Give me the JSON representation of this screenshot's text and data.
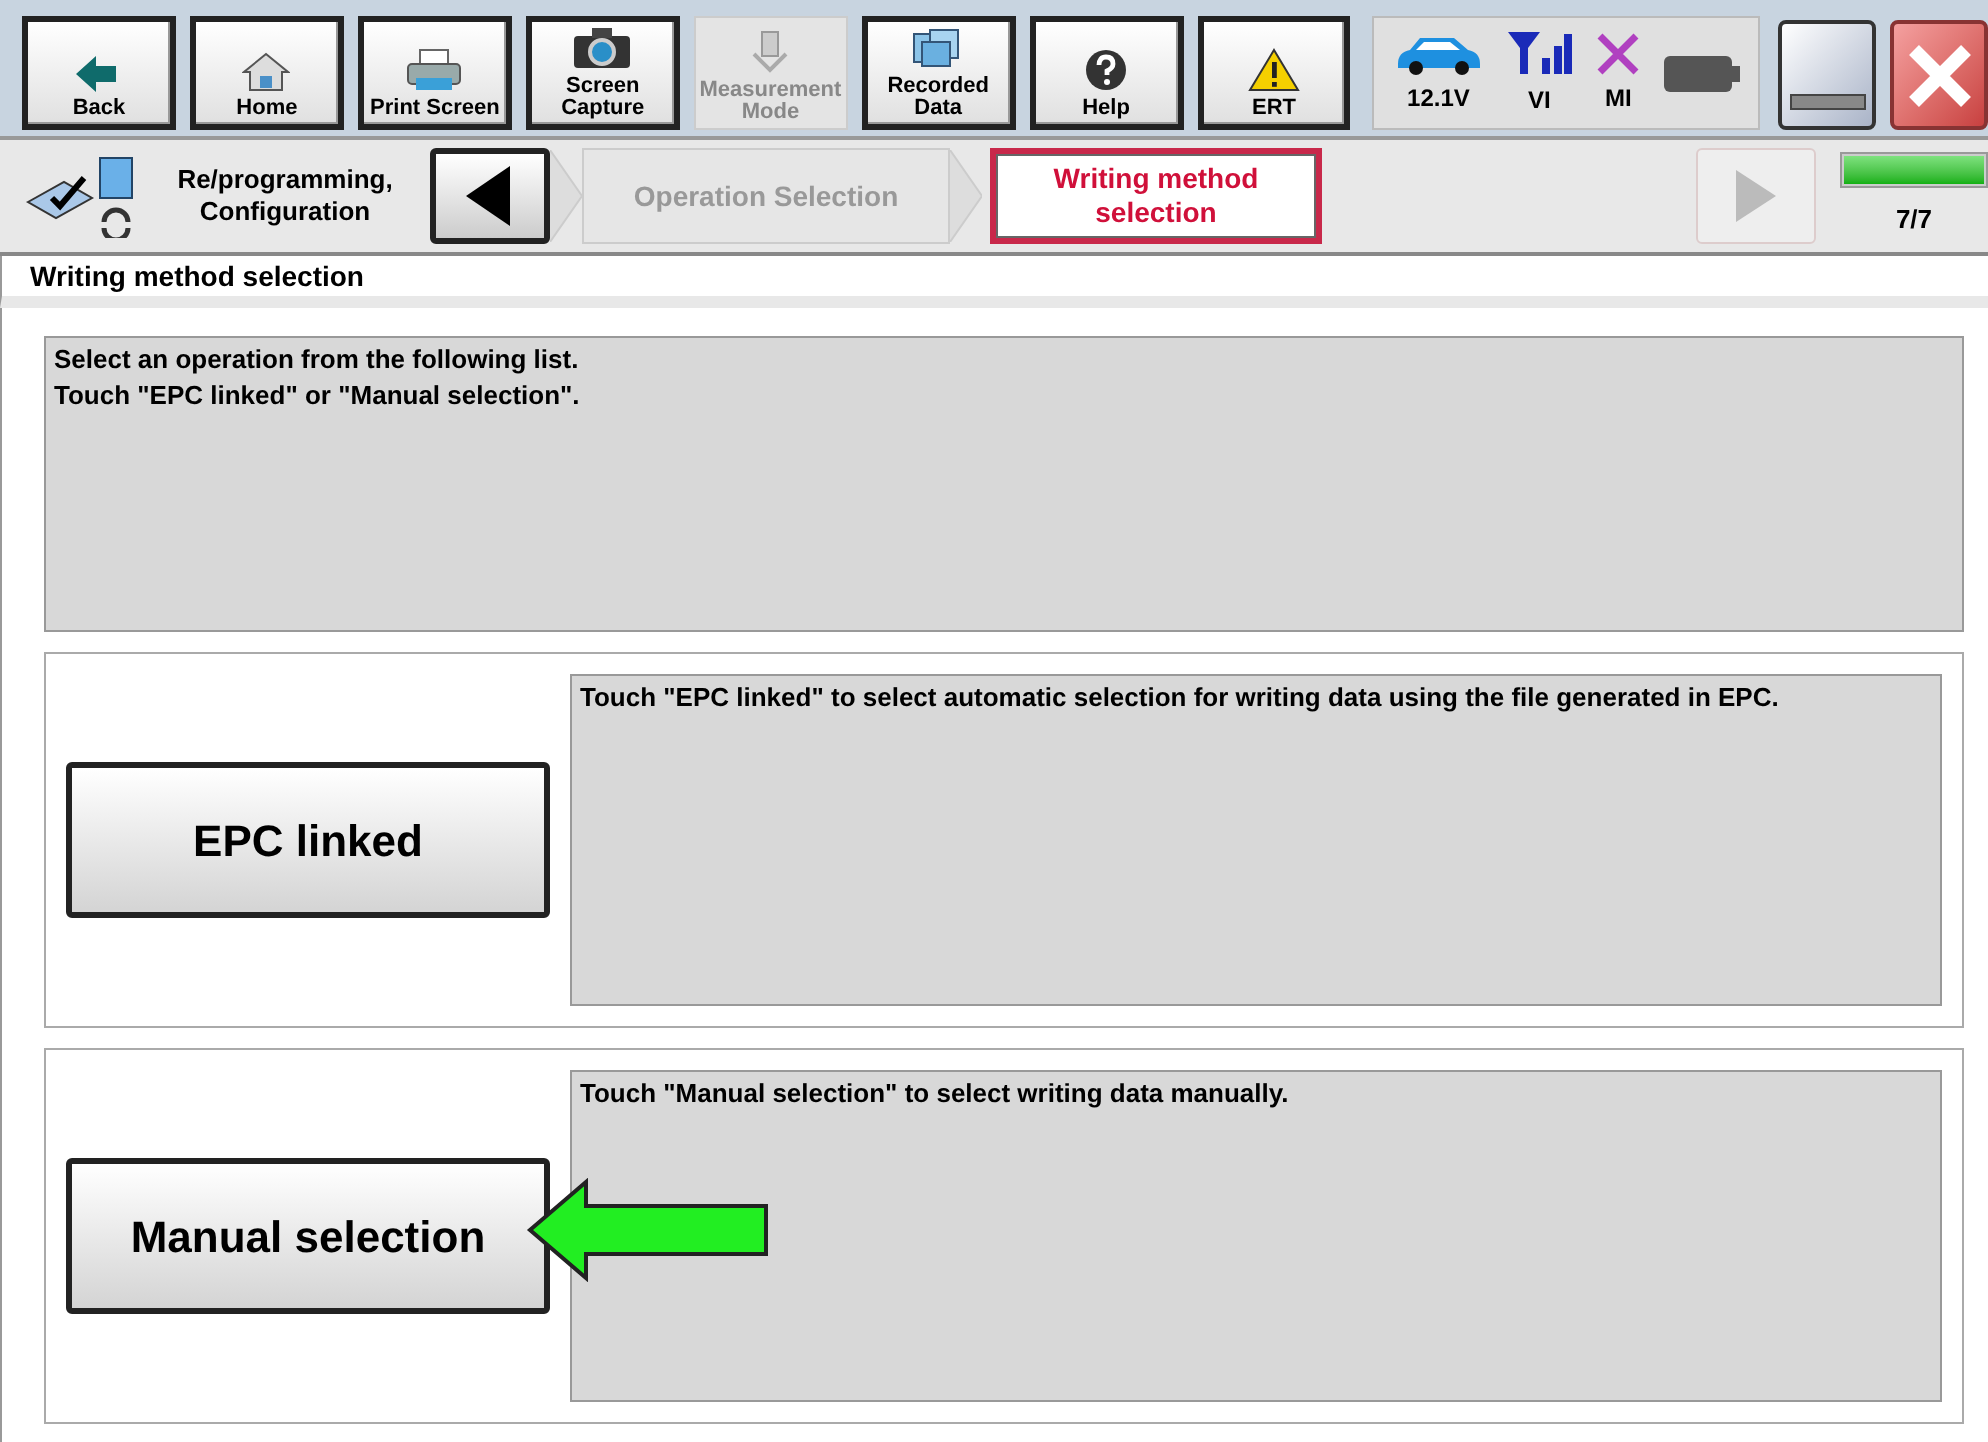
{
  "toolbar": {
    "buttons": [
      {
        "kind": "back",
        "label": "Back",
        "disabled": false
      },
      {
        "kind": "home",
        "label": "Home",
        "disabled": false
      },
      {
        "kind": "print",
        "label": "Print Screen",
        "disabled": false
      },
      {
        "kind": "camera",
        "label": "Screen Capture",
        "disabled": false
      },
      {
        "kind": "measure",
        "label": "Measurement Mode",
        "disabled": true
      },
      {
        "kind": "recorded",
        "label": "Recorded Data",
        "disabled": false
      },
      {
        "kind": "help",
        "label": "Help",
        "disabled": false
      },
      {
        "kind": "ert",
        "label": "ERT",
        "disabled": false
      }
    ],
    "status": [
      {
        "kind": "car",
        "label": "12.1V"
      },
      {
        "kind": "signal",
        "label": "VI"
      },
      {
        "kind": "cross",
        "label": "MI"
      },
      {
        "kind": "battery"
      }
    ]
  },
  "breadcrumb": {
    "section": "Re/programming, Configuration",
    "steps": [
      {
        "label": "Operation Selection",
        "selected": false
      },
      {
        "label": "Writing method selection",
        "selected": true
      }
    ],
    "progress": {
      "level": 1,
      "text": "7/7"
    }
  },
  "title": "Writing method selection",
  "instructions": [
    "Select an operation from the following list.",
    "Touch \"EPC linked\" or \"Manual selection\"."
  ],
  "options": [
    {
      "button": "EPC linked",
      "description": "Touch \"EPC linked\" to select automatic selection for writing data using the file generated in EPC.",
      "pointer": false
    },
    {
      "button": "Manual selection",
      "description": "Touch \"Manual selection\" to select writing data manually.",
      "pointer": true
    }
  ]
}
